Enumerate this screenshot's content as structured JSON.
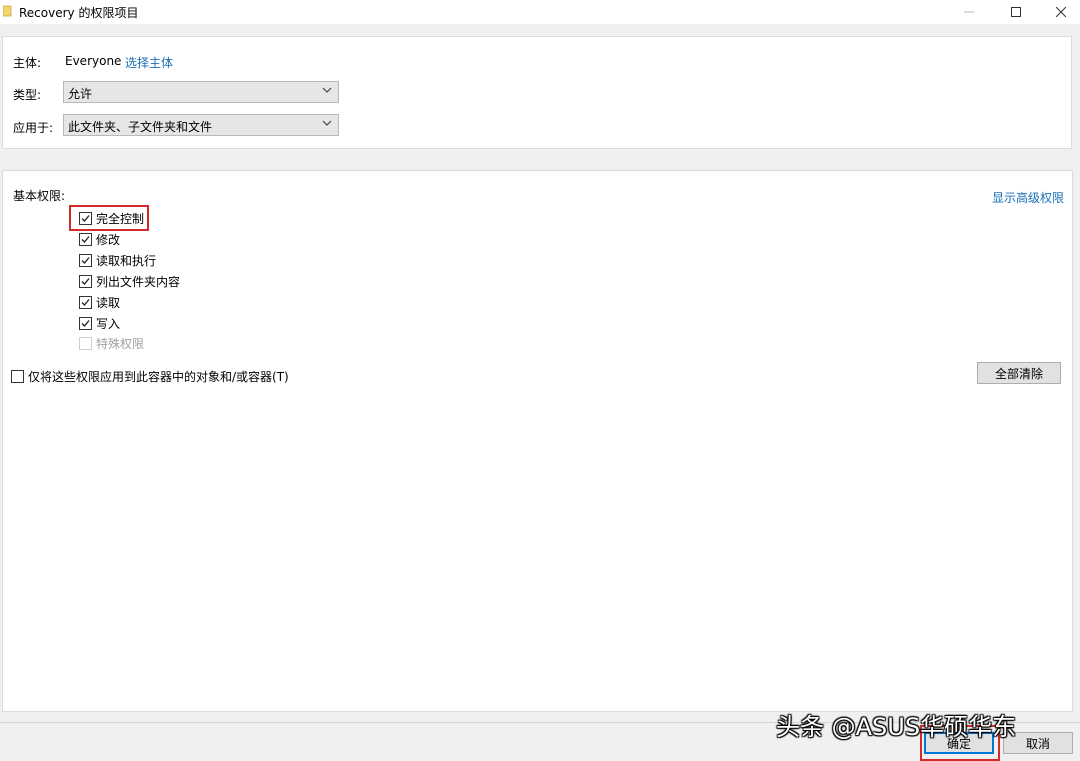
{
  "window": {
    "title": "Recovery 的权限项目",
    "minimize_glyph": "—",
    "maximize_glyph": "☐",
    "close_glyph": "✕"
  },
  "principal": {
    "label": "主体:",
    "value": "Everyone",
    "select_link": "选择主体"
  },
  "type": {
    "label": "类型:",
    "selected": "允许"
  },
  "applies_to": {
    "label": "应用于:",
    "selected": "此文件夹、子文件夹和文件"
  },
  "basic_permissions": {
    "heading": "基本权限:",
    "show_advanced_link": "显示高级权限",
    "items": [
      {
        "label": "完全控制",
        "checked": true,
        "enabled": true
      },
      {
        "label": "修改",
        "checked": true,
        "enabled": true
      },
      {
        "label": "读取和执行",
        "checked": true,
        "enabled": true
      },
      {
        "label": "列出文件夹内容",
        "checked": true,
        "enabled": true
      },
      {
        "label": "读取",
        "checked": true,
        "enabled": true
      },
      {
        "label": "写入",
        "checked": true,
        "enabled": true
      },
      {
        "label": "特殊权限",
        "checked": false,
        "enabled": false
      }
    ]
  },
  "apply_only_checkbox": {
    "label": "仅将这些权限应用到此容器中的对象和/或容器(T)",
    "checked": false
  },
  "clear_all_button": "全部清除",
  "footer": {
    "ok_button": "确定",
    "cancel_button": "取消"
  },
  "watermark": "头条 @ASUS华硕华东",
  "colors": {
    "link": "#1a6fb8",
    "highlight": "#d42a2a",
    "panel_bg": "#ffffff",
    "window_bg": "#f0f0f0"
  }
}
